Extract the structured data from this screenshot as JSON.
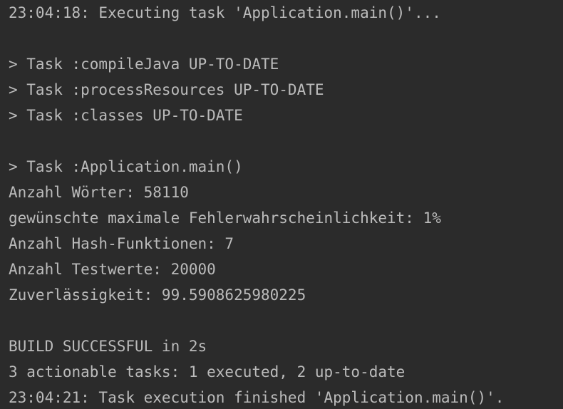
{
  "console": {
    "header_line": "23:04:18: Executing task 'Application.main()'...",
    "tasks": [
      "> Task :compileJava UP-TO-DATE",
      "> Task :processResources UP-TO-DATE",
      "> Task :classes UP-TO-DATE"
    ],
    "main_task": "> Task :Application.main()",
    "program_output": [
      "Anzahl Wörter: 58110",
      "gewünschte maximale Fehlerwahrscheinlichkeit: 1%",
      "Anzahl Hash-Funktionen: 7",
      "Anzahl Testwerte: 20000",
      "Zuverlässigkeit: 99.5908625980225"
    ],
    "build_result": "BUILD SUCCESSFUL in 2s",
    "summary": "3 actionable tasks: 1 executed, 2 up-to-date",
    "footer_line": "23:04:21: Task execution finished 'Application.main()'."
  },
  "colors": {
    "background": "#2b2b2b",
    "text": "#bbbbbb"
  }
}
